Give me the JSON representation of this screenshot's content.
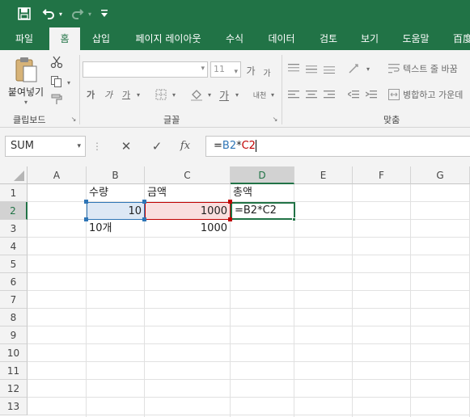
{
  "qat": {
    "save_icon": "save-icon",
    "undo_icon": "undo-icon",
    "redo_icon": "redo-icon",
    "customize_icon": "customize-qat-icon"
  },
  "tabs": [
    {
      "label": "파일"
    },
    {
      "label": "홈",
      "active": true
    },
    {
      "label": "삽입"
    },
    {
      "label": "페이지 레이아웃"
    },
    {
      "label": "수식"
    },
    {
      "label": "데이터"
    },
    {
      "label": "검토"
    },
    {
      "label": "보기"
    },
    {
      "label": "도움말"
    },
    {
      "label": "百度"
    }
  ],
  "ribbon": {
    "clipboard": {
      "paste_label": "붙여넣기",
      "group_label": "클립보드"
    },
    "font": {
      "font_name": "",
      "font_size": "11",
      "bold": "가",
      "italic": "가",
      "underline": "가",
      "font_color": "가",
      "phonetic": "내천",
      "grow": "가",
      "shrink": "가",
      "group_label": "글꼴"
    },
    "alignment": {
      "wrap_text": "텍스트 줄 바꿈",
      "merge_center": "병합하고 가운데",
      "group_label": "맞춤"
    }
  },
  "formula_bar": {
    "name_box": "SUM",
    "cancel": "✕",
    "enter": "✓",
    "fx": "fx",
    "formula": "=B2*C2",
    "formula_parts": [
      "=",
      "B2",
      "*",
      "C2"
    ]
  },
  "columns": [
    "A",
    "B",
    "C",
    "D",
    "E",
    "F",
    "G"
  ],
  "rows": [
    "1",
    "2",
    "3",
    "4",
    "5",
    "6",
    "7",
    "8",
    "9",
    "10",
    "11",
    "12",
    "13"
  ],
  "cells": {
    "B1": "수량",
    "C1": "금액",
    "D1": "총액",
    "B2": "10",
    "C2": "1000",
    "D2": "=B2*C2",
    "B3": "10개",
    "C3": "1000"
  },
  "colors": {
    "accent": "#217346",
    "ref_blue": "#2e75b6",
    "ref_red": "#c00000"
  }
}
